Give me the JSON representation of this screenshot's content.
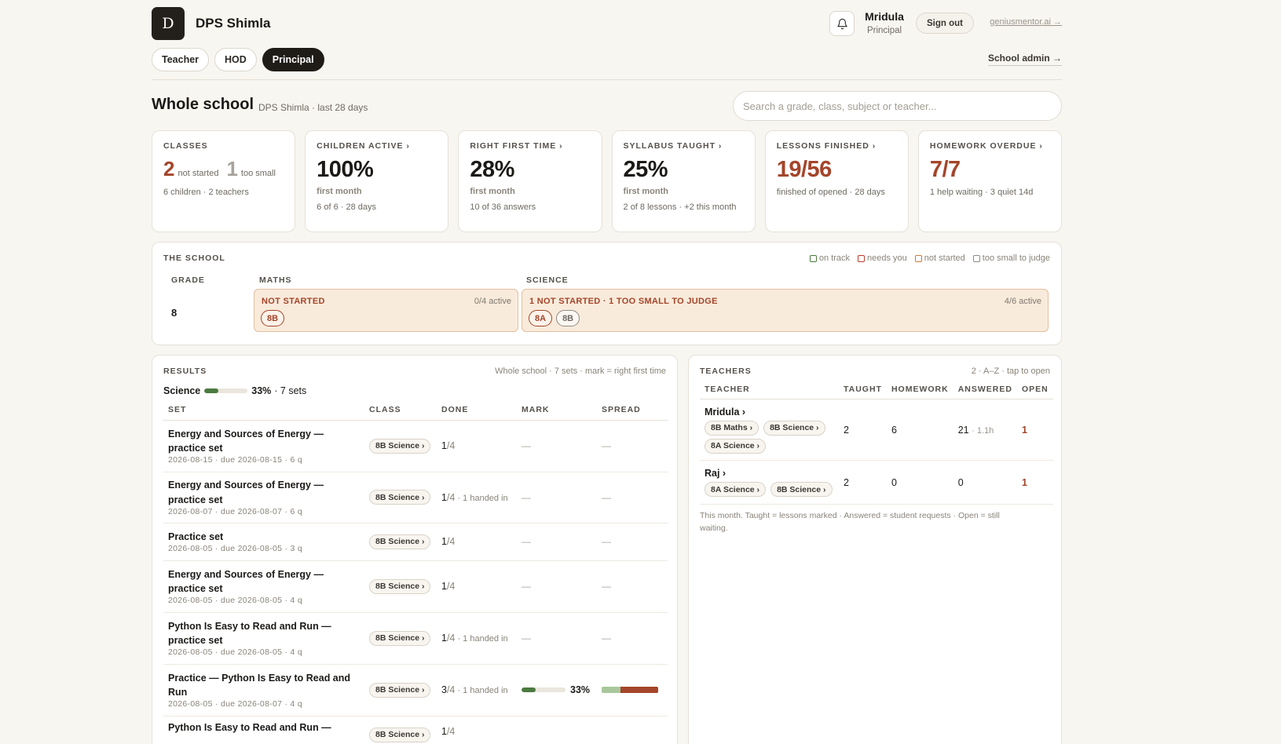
{
  "header": {
    "logo_letter": "D",
    "school": "DPS Shimla",
    "user_name": "Mridula",
    "user_role": "Principal",
    "signout": "Sign out",
    "external_link": "geniusmentor.ai →",
    "roles": [
      "Teacher",
      "HOD",
      "Principal"
    ],
    "active_role": "Principal",
    "school_admin": "School admin →"
  },
  "overview": {
    "title": "Whole school",
    "subtitle": "DPS Shimla · last 28 days",
    "search_placeholder": "Search a grade, class, subject or teacher..."
  },
  "cards": {
    "classes": {
      "label": "CLASSES",
      "not_started_n": "2",
      "not_started_t": "not started",
      "too_small_n": "1",
      "too_small_t": "too small",
      "foot": "6 children · 2 teachers"
    },
    "children_active": {
      "label": "CHILDREN ACTIVE ›",
      "value": "100%",
      "sub": "first month",
      "foot": "6 of 6 · 28 days"
    },
    "right_first_time": {
      "label": "RIGHT FIRST TIME ›",
      "value": "28%",
      "sub": "first month",
      "foot": "10 of 36 answers"
    },
    "syllabus_taught": {
      "label": "SYLLABUS TAUGHT ›",
      "value": "25%",
      "sub": "first month",
      "foot": "2 of 8 lessons · +2 this month"
    },
    "lessons_finished": {
      "label": "LESSONS FINISHED ›",
      "value": "19/56",
      "foot": "finished of opened · 28 days"
    },
    "homework_overdue": {
      "label": "HOMEWORK OVERDUE ›",
      "value": "7/7",
      "foot": "1 help waiting · 3 quiet 14d"
    }
  },
  "school_grid": {
    "label": "THE SCHOOL",
    "legend": [
      "on track",
      "needs you",
      "not started",
      "too small to judge"
    ],
    "legend_colors": [
      "#4b7a3f",
      "#c0392b",
      "#c97a3a",
      "#8f8a82"
    ],
    "col_grade": "GRADE",
    "subjects": [
      "MATHS",
      "SCIENCE"
    ],
    "grade": "8",
    "maths": {
      "status": "NOT STARTED",
      "active": "0/4 active",
      "classes": [
        "8B"
      ]
    },
    "science": {
      "status": "1 NOT STARTED · 1 TOO SMALL TO JUDGE",
      "active": "4/6 active",
      "classes": [
        "8A",
        "8B"
      ]
    }
  },
  "results": {
    "label": "RESULTS",
    "meta": "Whole school · 7 sets · mark = right first time",
    "subject": "Science",
    "subject_pct": "33%",
    "subject_pct_value": 0.33,
    "subject_sets": "· 7 sets",
    "columns": [
      "SET",
      "CLASS",
      "DONE",
      "MARK",
      "SPREAD"
    ],
    "rows": [
      {
        "name": "Energy and Sources of Energy — practice set",
        "meta": "2026-08-15 · due 2026-08-15 · 6 q",
        "class": "8B Science ›",
        "done": "1",
        "of": "/4",
        "handed": "",
        "mark": "—",
        "spread": "—"
      },
      {
        "name": "Energy and Sources of Energy — practice set",
        "meta": "2026-08-07 · due 2026-08-07 · 6 q",
        "class": "8B Science ›",
        "done": "1",
        "of": "/4",
        "handed": " · 1 handed in",
        "mark": "—",
        "spread": "—"
      },
      {
        "name": "Practice set",
        "meta": "2026-08-05 · due 2026-08-05 · 3 q",
        "class": "8B Science ›",
        "done": "1",
        "of": "/4",
        "handed": "",
        "mark": "—",
        "spread": "—"
      },
      {
        "name": "Energy and Sources of Energy — practice set",
        "meta": "2026-08-05 · due 2026-08-05 · 4 q",
        "class": "8B Science ›",
        "done": "1",
        "of": "/4",
        "handed": "",
        "mark": "—",
        "spread": "—"
      },
      {
        "name": "Python Is Easy to Read and Run — practice set",
        "meta": "2026-08-05 · due 2026-08-05 · 4 q",
        "class": "8B Science ›",
        "done": "1",
        "of": "/4",
        "handed": " · 1 handed in",
        "mark": "—",
        "spread": "—"
      },
      {
        "name": "Practice — Python Is Easy to Read and Run",
        "meta": "2026-08-05 · due 2026-08-07 · 4 q",
        "class": "8B Science ›",
        "done": "3",
        "of": "/4",
        "handed": " · 1 handed in",
        "mark": "33%",
        "mark_value": 0.33,
        "spread": ""
      },
      {
        "name": "Python Is Easy to Read and Run —",
        "meta": "",
        "class": "8B Science ›",
        "done": "1",
        "of": "/4",
        "handed": "",
        "mark": "",
        "spread": ""
      }
    ]
  },
  "teachers": {
    "label": "TEACHERS",
    "meta": "2 · A–Z · tap to open",
    "columns": [
      "TEACHER",
      "TAUGHT",
      "HOMEWORK",
      "ANSWERED",
      "OPEN"
    ],
    "rows": [
      {
        "name": "Mridula ›",
        "classes": [
          "8B Maths ›",
          "8B Science ›",
          "8A Science ›"
        ],
        "taught": "2",
        "homework": "6",
        "answered": "21",
        "answered_extra": "· 1.1h",
        "open": "1"
      },
      {
        "name": "Raj ›",
        "classes": [
          "8A Science ›",
          "8B Science ›"
        ],
        "taught": "2",
        "homework": "0",
        "answered": "0",
        "answered_extra": "",
        "open": "1"
      }
    ],
    "note": "This month. Taught = lessons marked · Answered = student requests · Open = still waiting."
  },
  "colors": {
    "accent": "#a4452a",
    "good": "#4b7a3f",
    "dark": "#1f1c18",
    "spread_light": "#a9c79c"
  }
}
